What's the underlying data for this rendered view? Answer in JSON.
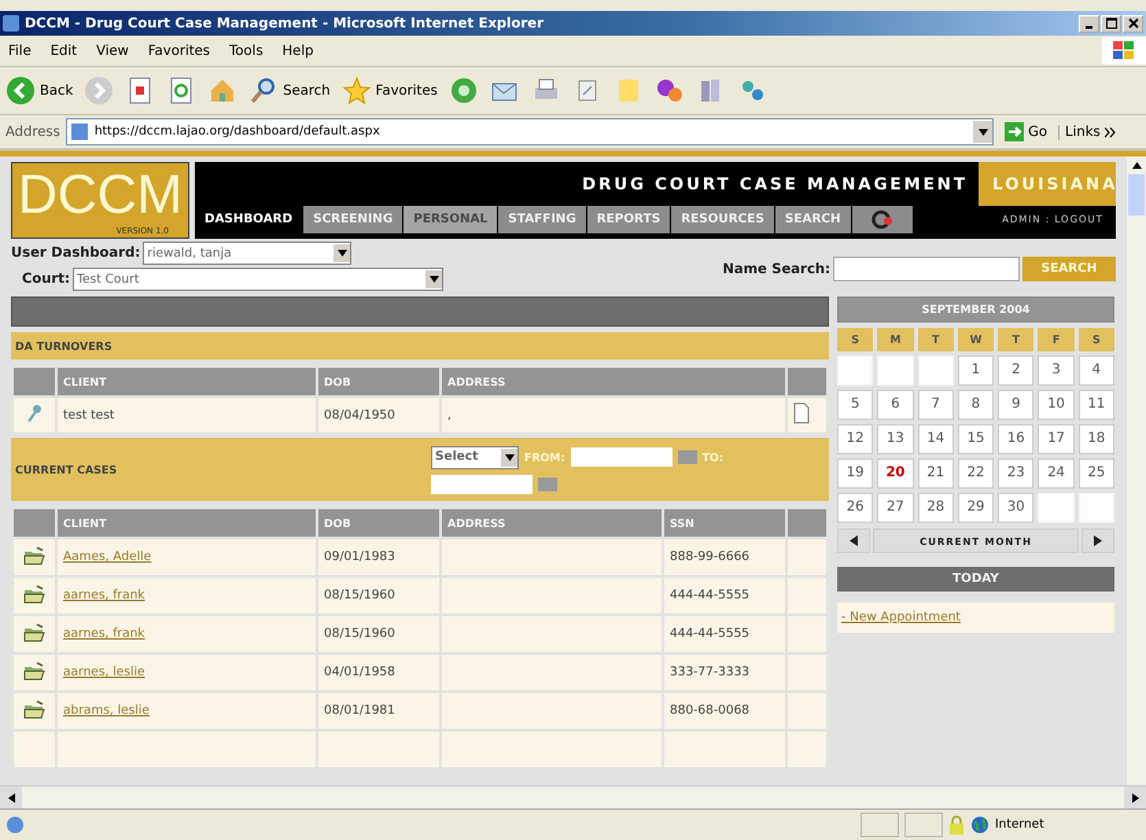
{
  "window": {
    "title": "DCCM - Drug Court Case Management - Microsoft Internet Explorer"
  },
  "menu": [
    "File",
    "Edit",
    "View",
    "Favorites",
    "Tools",
    "Help"
  ],
  "toolbar": [
    {
      "kind": "back",
      "label": "Back"
    },
    {
      "kind": "forward"
    },
    {
      "kind": "stop"
    },
    {
      "kind": "refresh"
    },
    {
      "kind": "home"
    },
    {
      "kind": "search",
      "label": "Search"
    },
    {
      "kind": "favorites",
      "label": "Favorites"
    },
    {
      "kind": "media"
    },
    {
      "kind": "mail"
    },
    {
      "kind": "print"
    },
    {
      "kind": "edit"
    },
    {
      "kind": "notes"
    },
    {
      "kind": "messenger"
    },
    {
      "kind": "research"
    },
    {
      "kind": "network"
    }
  ],
  "address": {
    "label": "Address",
    "value": "https://dccm.lajao.org/dashboard/default.aspx",
    "go": "Go",
    "links": "Links"
  },
  "site": {
    "logo": "DCCM",
    "version": "VERSION 1.0",
    "title": "DRUG COURT CASE MANAGEMENT",
    "state": "LOUISIANA",
    "account": "ADMIN : LOGOUT"
  },
  "nav": [
    {
      "label": "DASHBOARD",
      "selected": true,
      "disabled": false
    },
    {
      "label": "SCREENING",
      "selected": false,
      "disabled": false
    },
    {
      "label": "PERSONAL",
      "selected": false,
      "disabled": true
    },
    {
      "label": "STAFFING",
      "selected": false,
      "disabled": false
    },
    {
      "label": "REPORTS",
      "selected": false,
      "disabled": false
    },
    {
      "label": "RESOURCES",
      "selected": false,
      "disabled": false
    },
    {
      "label": "SEARCH",
      "selected": false,
      "disabled": false
    }
  ],
  "filters": {
    "user_label": "User Dashboard:",
    "user_value": "riewald, tanja",
    "court_label": "Court:",
    "court_value": "Test Court",
    "search_label": "Name Search:",
    "search_button": "SEARCH"
  },
  "turnovers": {
    "title": "DA TURNOVERS",
    "columns": [
      "CLIENT",
      "DOB",
      "ADDRESS"
    ],
    "rows": [
      {
        "client": "test test",
        "dob": "08/04/1950",
        "address": ","
      }
    ]
  },
  "current_cases": {
    "title": "CURRENT CASES",
    "select": "Select",
    "from_label": "FROM:",
    "to_label": "TO:",
    "columns": [
      "CLIENT",
      "DOB",
      "ADDRESS",
      "SSN"
    ],
    "rows": [
      {
        "client": "Aames, Adelle",
        "dob": "09/01/1983",
        "ssn": "888-99-6666"
      },
      {
        "client": "aarnes, frank",
        "dob": "08/15/1960",
        "ssn": "444-44-5555"
      },
      {
        "client": "aarnes, frank",
        "dob": "08/15/1960",
        "ssn": "444-44-5555"
      },
      {
        "client": "aarnes, leslie",
        "dob": "04/01/1958",
        "ssn": "333-77-3333"
      },
      {
        "client": "abrams, leslie",
        "dob": "08/01/1981",
        "ssn": "880-68-0068"
      }
    ]
  },
  "calendar": {
    "title": "SEPTEMBER 2004",
    "weekdays": [
      "S",
      "M",
      "T",
      "W",
      "T",
      "F",
      "S"
    ],
    "weeks": [
      [
        {
          "kind": "empty"
        },
        {
          "kind": "empty"
        },
        {
          "kind": "empty"
        },
        {
          "d": "1",
          "today": false
        },
        {
          "d": "2",
          "today": false
        },
        {
          "d": "3",
          "today": false
        },
        {
          "d": "4",
          "today": false
        }
      ],
      [
        {
          "d": "5",
          "today": false
        },
        {
          "d": "6",
          "today": false
        },
        {
          "d": "7",
          "today": false
        },
        {
          "d": "8",
          "today": false
        },
        {
          "d": "9",
          "today": false
        },
        {
          "d": "10",
          "today": false
        },
        {
          "d": "11",
          "today": false
        }
      ],
      [
        {
          "d": "12",
          "today": false
        },
        {
          "d": "13",
          "today": false
        },
        {
          "d": "14",
          "today": false
        },
        {
          "d": "15",
          "today": false
        },
        {
          "d": "16",
          "today": false
        },
        {
          "d": "17",
          "today": false
        },
        {
          "d": "18",
          "today": false
        }
      ],
      [
        {
          "d": "19",
          "today": false
        },
        {
          "d": "20",
          "today": true
        },
        {
          "d": "21",
          "today": false
        },
        {
          "d": "22",
          "today": false
        },
        {
          "d": "23",
          "today": false
        },
        {
          "d": "24",
          "today": false
        },
        {
          "d": "25",
          "today": false
        }
      ],
      [
        {
          "d": "26",
          "today": false
        },
        {
          "d": "27",
          "today": false
        },
        {
          "d": "28",
          "today": false
        },
        {
          "d": "29",
          "today": false
        },
        {
          "d": "30",
          "today": false
        },
        {
          "kind": "empty"
        },
        {
          "kind": "empty"
        }
      ]
    ],
    "month_button": "CURRENT MONTH",
    "today_title": "TODAY",
    "appointment_link": "- New Appointment"
  },
  "status_bar": {
    "zone": "Internet"
  }
}
